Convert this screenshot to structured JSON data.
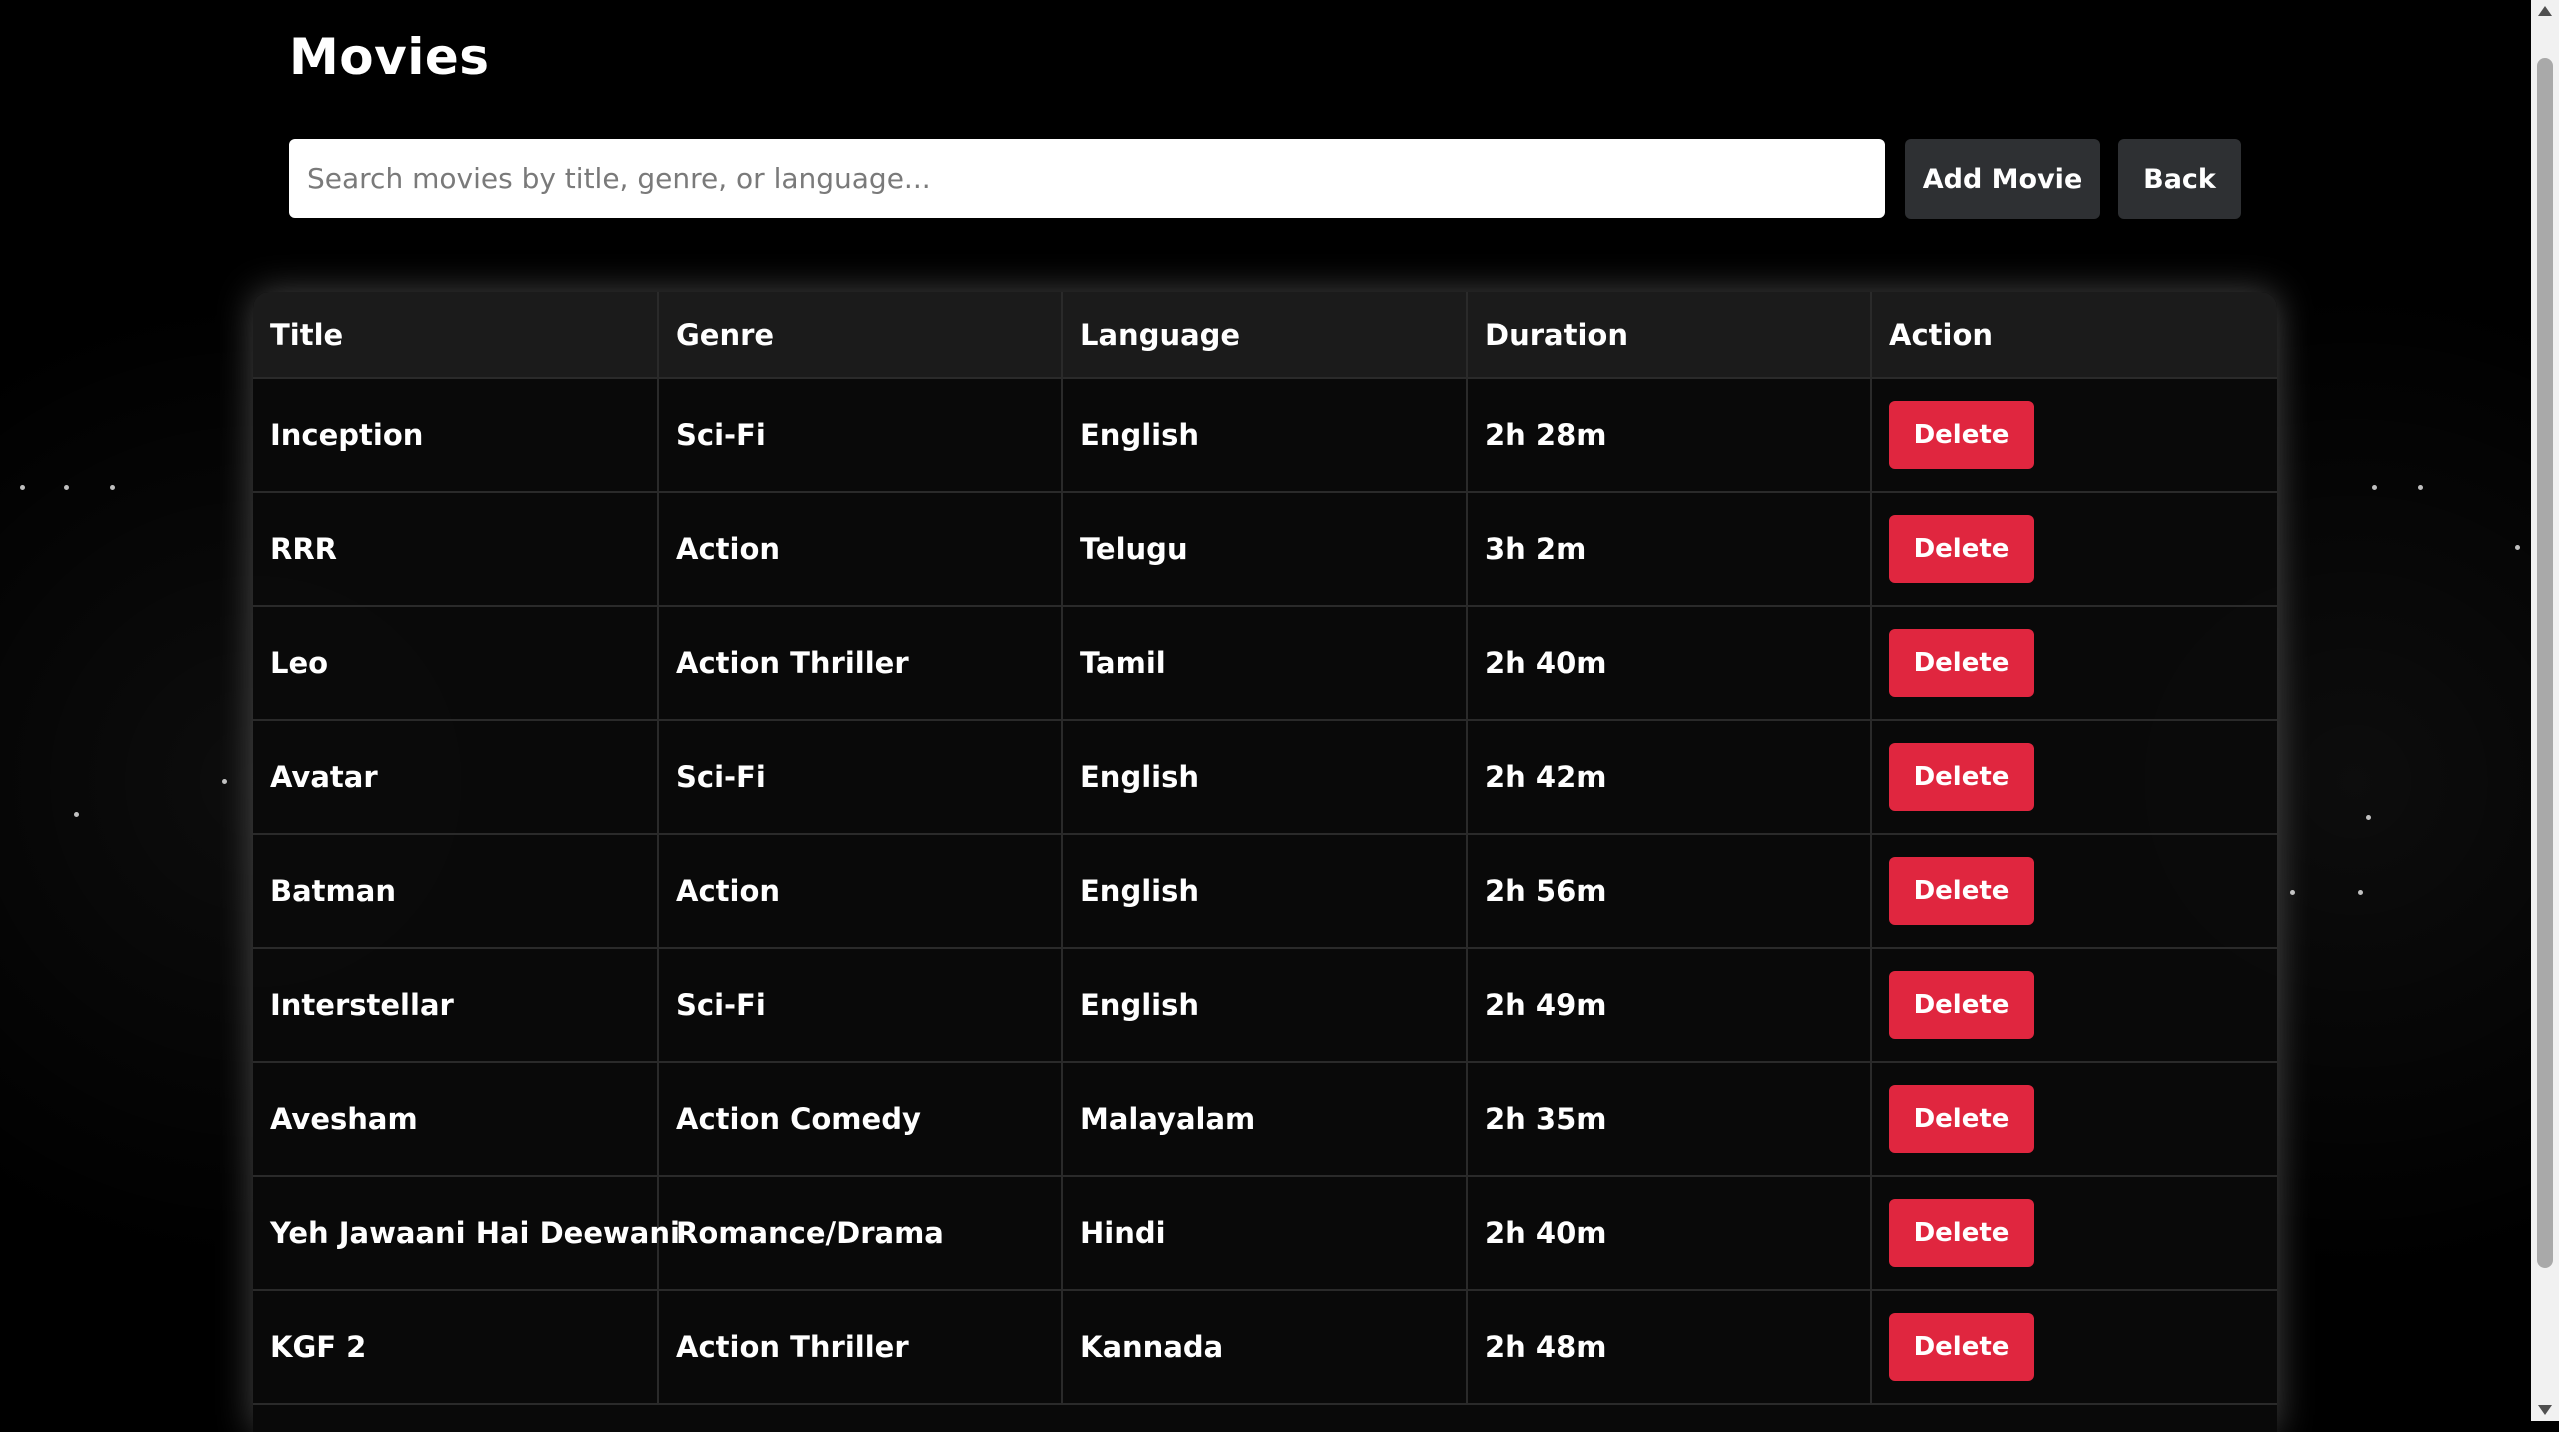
{
  "page": {
    "title": "Movies"
  },
  "search": {
    "placeholder": "Search movies by title, genre, or language...",
    "value": ""
  },
  "toolbar": {
    "add_label": "Add Movie",
    "back_label": "Back"
  },
  "table": {
    "headers": [
      "Title",
      "Genre",
      "Language",
      "Duration",
      "Action"
    ],
    "rows": [
      {
        "title": "Inception",
        "genre": "Sci-Fi",
        "language": "English",
        "duration": "2h 28m",
        "action": "Delete"
      },
      {
        "title": "RRR",
        "genre": "Action",
        "language": "Telugu",
        "duration": "3h 2m",
        "action": "Delete"
      },
      {
        "title": "Leo",
        "genre": "Action Thriller",
        "language": "Tamil",
        "duration": "2h 40m",
        "action": "Delete"
      },
      {
        "title": "Avatar",
        "genre": "Sci-Fi",
        "language": "English",
        "duration": "2h 42m",
        "action": "Delete"
      },
      {
        "title": "Batman",
        "genre": "Action",
        "language": "English",
        "duration": "2h 56m",
        "action": "Delete"
      },
      {
        "title": "Interstellar",
        "genre": "Sci-Fi",
        "language": "English",
        "duration": "2h 49m",
        "action": "Delete"
      },
      {
        "title": "Avesham",
        "genre": "Action Comedy",
        "language": "Malayalam",
        "duration": "2h 35m",
        "action": "Delete"
      },
      {
        "title": "Yeh Jawaani Hai Deewani",
        "genre": "Romance/Drama",
        "language": "Hindi",
        "duration": "2h 40m",
        "action": "Delete"
      },
      {
        "title": "KGF 2",
        "genre": "Action Thriller",
        "language": "Kannada",
        "duration": "2h 48m",
        "action": "Delete"
      }
    ]
  },
  "colors": {
    "background": "#000000",
    "delete_button": "#e0263f",
    "toolbar_button": "#2e3033",
    "header_row": "#1b1b1b"
  },
  "icons": {
    "scroll_up": "scroll-up-arrow-icon",
    "scroll_down": "scroll-down-arrow-icon"
  }
}
